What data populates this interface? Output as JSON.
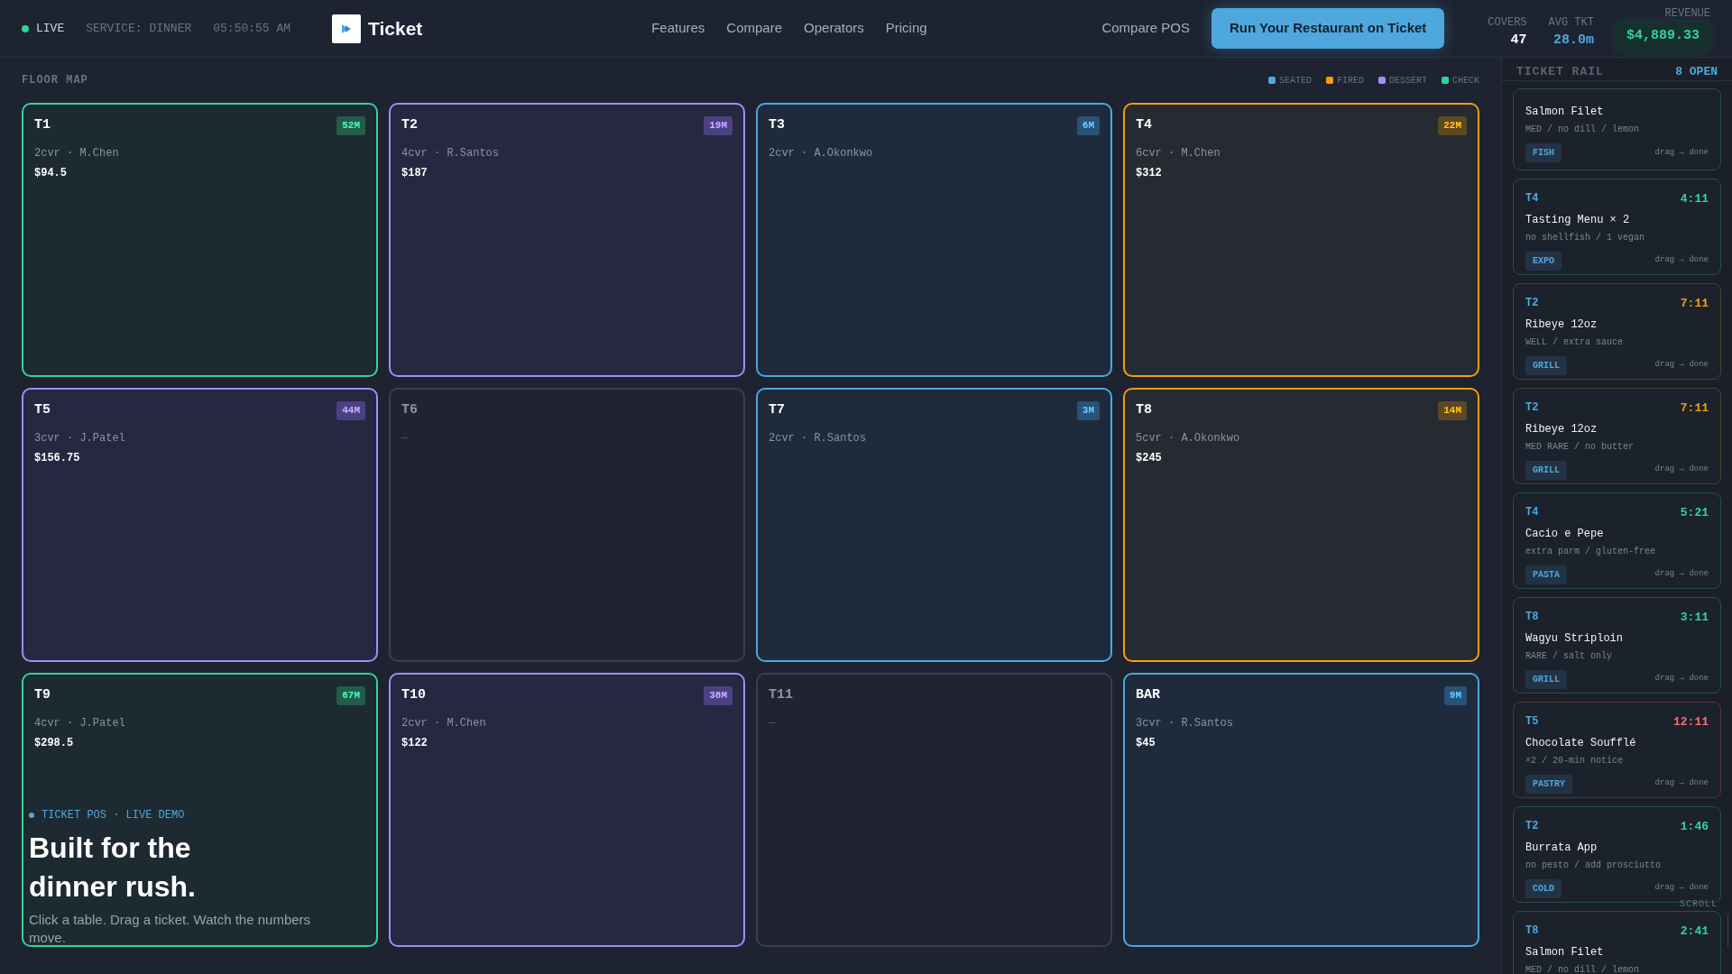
{
  "status": {
    "live": "LIVE",
    "service": "SERVICE: DINNER",
    "clock": "05:50:55 AM"
  },
  "brand": {
    "name": "Ticket"
  },
  "nav": [
    {
      "label": "Features"
    },
    {
      "label": "Compare"
    },
    {
      "label": "Operators"
    },
    {
      "label": "Pricing"
    }
  ],
  "secondary_link": "Compare POS",
  "cta": "Run Your Restaurant on Ticket",
  "stats": [
    {
      "label": "COVERS",
      "value": "47",
      "kind": "plain"
    },
    {
      "label": "AVG TKT",
      "value": "28.0m",
      "kind": "accent"
    },
    {
      "label": "REVENUE",
      "value": "$4,889.33",
      "kind": "money"
    }
  ],
  "floor_map": {
    "title": "FLOOR MAP",
    "legend": [
      {
        "label": "SEATED",
        "color": "#4ea8de"
      },
      {
        "label": "FIRED",
        "color": "#f59e0b"
      },
      {
        "label": "DESSERT",
        "color": "#a78bfa"
      },
      {
        "label": "CHECK",
        "color": "#34d399"
      }
    ],
    "tables": [
      {
        "name": "T1",
        "kind": "check",
        "badge": "52M",
        "detail": "2cvr · M.Chen",
        "amount": "$94.5"
      },
      {
        "name": "T2",
        "kind": "dessert",
        "badge": "19M",
        "detail": "4cvr · R.Santos",
        "amount": "$187"
      },
      {
        "name": "T3",
        "kind": "seated",
        "badge": "6M",
        "detail": "2cvr · A.Okonkwo"
      },
      {
        "name": "T4",
        "kind": "fired",
        "badge": "22M",
        "detail": "6cvr · M.Chen",
        "amount": "$312"
      },
      {
        "name": "T5",
        "kind": "dessert",
        "badge": "44M",
        "detail": "3cvr · J.Patel",
        "amount": "$156.75"
      },
      {
        "name": "T6",
        "kind": "empty",
        "detail": "—"
      },
      {
        "name": "T7",
        "kind": "seated",
        "badge": "3M",
        "detail": "2cvr · R.Santos"
      },
      {
        "name": "T8",
        "kind": "fired",
        "badge": "14M",
        "detail": "5cvr · A.Okonkwo",
        "amount": "$245"
      },
      {
        "name": "T9",
        "kind": "check",
        "badge": "67M",
        "detail": "4cvr · J.Patel",
        "amount": "$298.5"
      },
      {
        "name": "T10",
        "kind": "dessert",
        "badge": "38M",
        "detail": "2cvr · M.Chen",
        "amount": "$122"
      },
      {
        "name": "T11",
        "kind": "empty",
        "detail": "—"
      },
      {
        "name": "BAR",
        "kind": "seated",
        "badge": "9M",
        "detail": "3cvr · R.Santos",
        "amount": "$45"
      }
    ]
  },
  "hero": {
    "eyebrow": "TICKET POS · LIVE DEMO",
    "headline": "Built for the dinner rush.",
    "sub": "Click a table. Drag a ticket. Watch the numbers move."
  },
  "ticket_rail": {
    "title": "TICKET RAIL",
    "count": "8 OPEN",
    "tickets": [
      {
        "kind": "ok",
        "dish": "Salmon Filet",
        "mods": "MED / no dill / lemon",
        "station": "FISH",
        "hint": "drag → done"
      },
      {
        "kind": "ok",
        "table": "T4",
        "time": "4:11",
        "dish": "Tasting Menu × 2",
        "mods": "no shellfish / 1 vegan",
        "station": "EXPO",
        "hint": "drag → done"
      },
      {
        "kind": "warn",
        "table": "T2",
        "time": "7:11",
        "dish": "Ribeye 12oz",
        "mods": "WELL / extra sauce",
        "station": "GRILL",
        "hint": "drag → done"
      },
      {
        "kind": "warn",
        "table": "T2",
        "time": "7:11",
        "dish": "Ribeye 12oz",
        "mods": "MED RARE / no butter",
        "station": "GRILL",
        "hint": "drag → done"
      },
      {
        "kind": "ok",
        "table": "T4",
        "time": "5:21",
        "dish": "Cacio e Pepe",
        "mods": "extra parm / gluten-free",
        "station": "PASTA",
        "hint": "drag → done"
      },
      {
        "kind": "ok",
        "table": "T8",
        "time": "3:11",
        "dish": "Wagyu Striploin",
        "mods": "RARE / salt only",
        "station": "GRILL",
        "hint": "drag → done"
      },
      {
        "kind": "late",
        "table": "T5",
        "time": "12:11",
        "dish": "Chocolate Soufflé",
        "mods": "×2 / 20-min notice",
        "station": "PASTRY",
        "hint": "drag → done"
      },
      {
        "kind": "ok",
        "table": "T2",
        "time": "1:46",
        "dish": "Burrata App",
        "mods": "no pesto / add prosciutto",
        "station": "COLD",
        "hint": "drag → done"
      },
      {
        "kind": "ok",
        "table": "T8",
        "time": "2:41",
        "dish": "Salmon Filet",
        "mods": "MED / no dill / lemon"
      }
    ],
    "scroll_hint": "SCROLL"
  }
}
